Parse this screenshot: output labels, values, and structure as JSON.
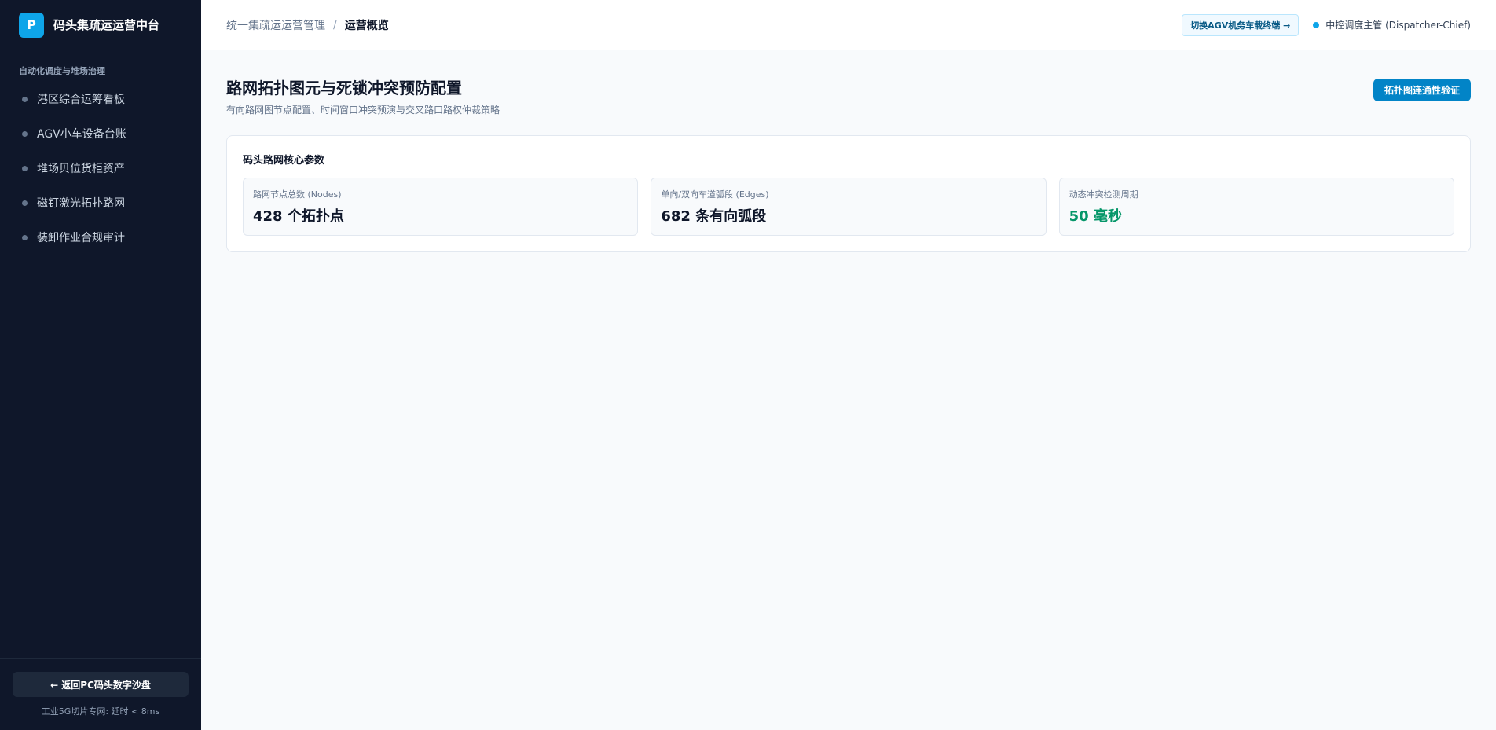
{
  "brand": {
    "logo_letter": "P",
    "name": "码头集疏运运营中台"
  },
  "sidebar": {
    "section_title": "自动化调度与堆场治理",
    "items": [
      {
        "label": "港区综合运筹看板"
      },
      {
        "label": "AGV小车设备台账"
      },
      {
        "label": "堆场贝位货柜资产"
      },
      {
        "label": "磁钉激光拓扑路网"
      },
      {
        "label": "装卸作业合规审计"
      }
    ],
    "back_button": "← 返回PC码头数字沙盘",
    "network_status": "工业5G切片专网: 延时 < 8ms"
  },
  "topbar": {
    "breadcrumb_parent": "统一集疏运运营管理",
    "breadcrumb_separator": "/",
    "breadcrumb_current": "运营概览",
    "switch_button": "切换AGV机务车载终端 →",
    "user_role": "中控调度主管 (Dispatcher-Chief)"
  },
  "page": {
    "title": "路网拓扑图元与死锁冲突预防配置",
    "subtitle": "有向路网图节点配置、时间窗口冲突预演与交叉路口路权仲裁策略",
    "verify_button": "拓扑图连通性验证"
  },
  "params_card": {
    "title": "码头路网核心参数",
    "metrics": [
      {
        "label": "路网节点总数 (Nodes)",
        "value": "428 个拓扑点"
      },
      {
        "label": "单向/双向车道弧段 (Edges)",
        "value": "682 条有向弧段"
      },
      {
        "label": "动态冲突检测周期",
        "value": "50 毫秒"
      }
    ]
  },
  "colors": {
    "sidebar_bg": "#0f172a",
    "accent": "#0ea5e9",
    "primary_button": "#0284c7",
    "success_value": "#059669"
  }
}
